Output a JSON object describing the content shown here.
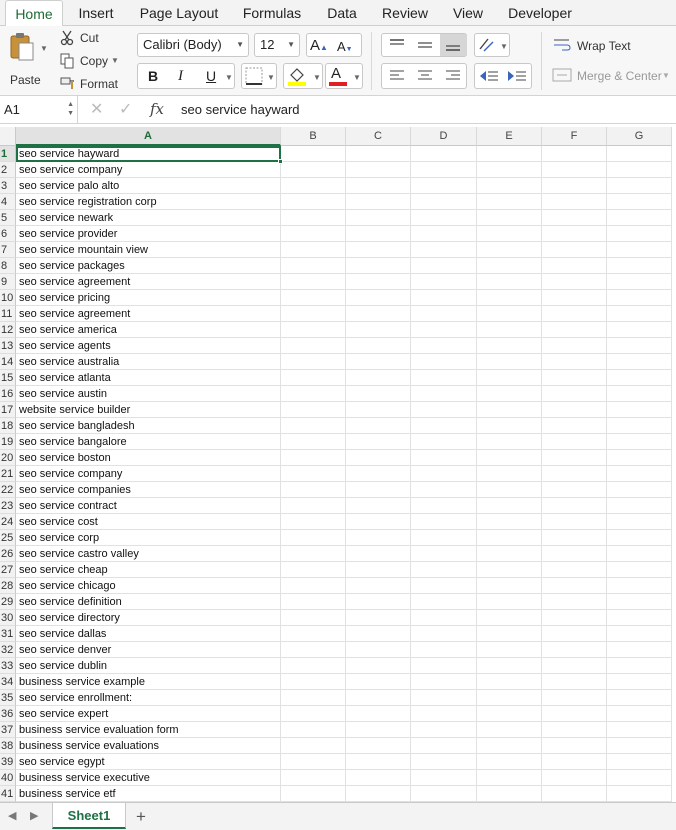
{
  "ribbon_tabs": [
    "Home",
    "Insert",
    "Page Layout",
    "Formulas",
    "Data",
    "Review",
    "View",
    "Developer"
  ],
  "clipboard": {
    "paste": "Paste",
    "cut": "Cut",
    "copy": "Copy",
    "format": "Format"
  },
  "font": {
    "family": "Calibri (Body)",
    "size": "12",
    "bold": "B",
    "italic": "I",
    "underline": "U",
    "grow": "A",
    "shrink": "A",
    "color_letter": "A"
  },
  "colors": {
    "highlight": "#ffff00",
    "font_color": "#e02020",
    "accent": "#1e7145"
  },
  "alignment": {
    "wrap_text": "Wrap Text",
    "merge_center": "Merge & Center"
  },
  "formula_bar": {
    "cell_ref": "A1",
    "fx": "fx",
    "value": "seo service hayward"
  },
  "columns": [
    "A",
    "B",
    "C",
    "D",
    "E",
    "F",
    "G"
  ],
  "rows": [
    "seo service hayward",
    "seo service company",
    "seo service palo alto",
    "seo service registration corp",
    "seo service newark",
    "seo service provider",
    "seo service mountain view",
    "seo service packages",
    "seo service agreement",
    "seo service pricing",
    "seo service agreement",
    "seo service america",
    "seo service agents",
    "seo service australia",
    "seo service atlanta",
    "seo service austin",
    "website service builder",
    "seo service bangladesh",
    "seo service bangalore",
    "seo service boston",
    "seo service company",
    "seo service companies",
    "seo service contract",
    "seo service cost",
    "seo service corp",
    "seo service castro valley",
    "seo service cheap",
    "seo service chicago",
    "seo service definition",
    "seo service directory",
    "seo service dallas",
    "seo service denver",
    "seo service dublin",
    "business service example",
    "seo service enrollment:",
    "seo service expert",
    "business service evaluation form",
    "business service evaluations",
    "seo service egypt",
    "business service executive",
    "business service etf"
  ],
  "sheet": {
    "name": "Sheet1",
    "add": "+"
  }
}
